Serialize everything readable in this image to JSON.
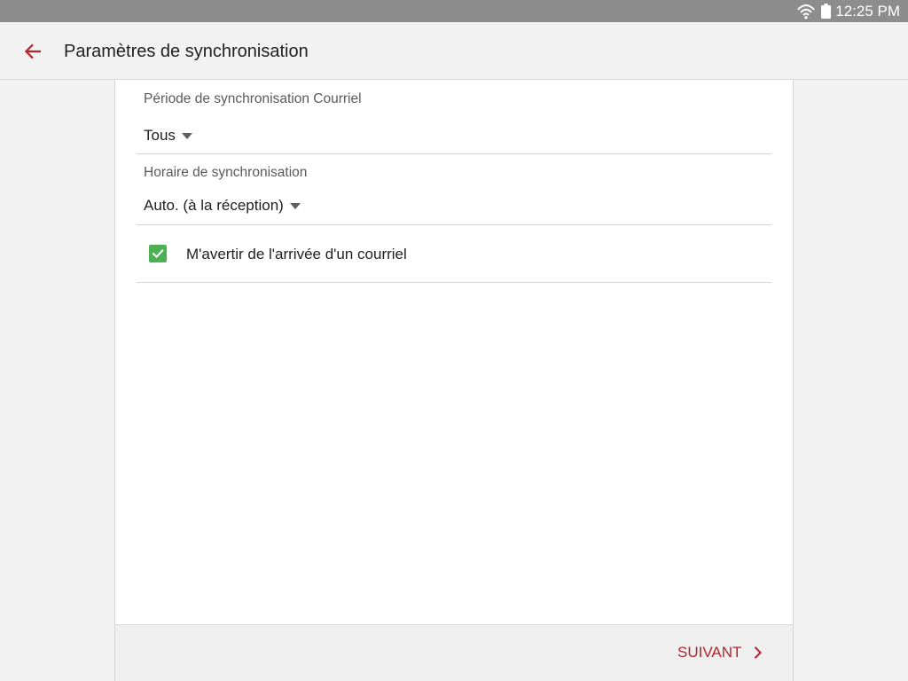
{
  "status_bar": {
    "time": "12:25 PM",
    "wifi_icon": "wifi-icon",
    "battery_icon": "battery-icon"
  },
  "app_bar": {
    "back_icon": "back-arrow-icon",
    "title": "Paramètres de synchronisation"
  },
  "settings": {
    "sync_period": {
      "label": "Période de synchronisation Courriel",
      "value": "Tous",
      "icon": "dropdown-arrow-icon"
    },
    "sync_schedule": {
      "label": "Horaire de synchronisation",
      "value": "Auto. (à la réception)",
      "icon": "dropdown-arrow-icon"
    },
    "notify_new_email": {
      "label": "M'avertir de l'arrivée d'un courriel",
      "checked": true,
      "icon": "checkmark-icon"
    }
  },
  "footer": {
    "next_label": "SUIVANT",
    "next_icon": "chevron-right-icon"
  },
  "colors": {
    "status_bar": "#8d8d8d",
    "accent": "#b3262b",
    "checkbox": "#4db052",
    "background": "#f2f2f2",
    "card": "#ffffff"
  }
}
